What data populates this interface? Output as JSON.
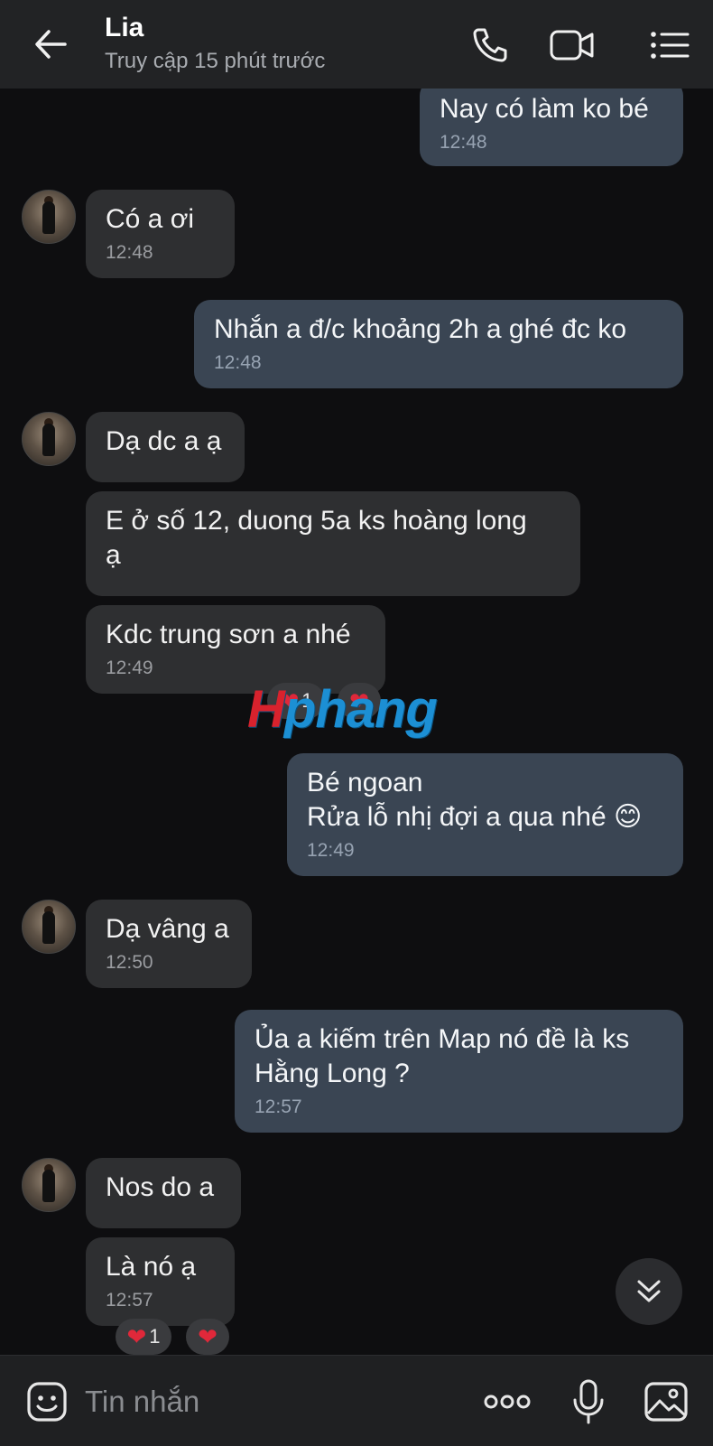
{
  "header": {
    "contact_name": "Lia",
    "status": "Truy cập 15 phút trước",
    "icons": [
      "back-arrow-icon",
      "phone-icon",
      "video-call-icon",
      "list-menu-icon"
    ]
  },
  "messages": [
    {
      "side": "out",
      "text": "Nay có làm ko bé",
      "time": "12:48"
    },
    {
      "side": "in",
      "text": "Có a ơi",
      "time": "12:48"
    },
    {
      "side": "out",
      "text": "Nhắn a đ/c khoảng 2h a ghé đc ko",
      "time": "12:48"
    },
    {
      "side": "in",
      "text": "Dạ dc a ạ",
      "time": ""
    },
    {
      "side": "in",
      "text": "E ở số 12, duong 5a ks hoàng long\nạ",
      "time": ""
    },
    {
      "side": "in",
      "text": "Kdc trung sơn a nhé",
      "time": "12:49"
    },
    {
      "side": "out",
      "text": "Bé ngoan\nRửa lỗ nhị đợi a qua nhé 😊",
      "time": "12:49"
    },
    {
      "side": "in",
      "text": "Dạ vâng a",
      "time": "12:50"
    },
    {
      "side": "out",
      "text": "Ủa a kiếm trên Map nó đề là ks\nHằng Long ?",
      "time": "12:57"
    },
    {
      "side": "in",
      "text": "Nos do a",
      "time": ""
    },
    {
      "side": "in",
      "text": "Là nó ạ",
      "time": "12:57"
    }
  ],
  "reactions": [
    {
      "emoji": "❤️",
      "count": "1"
    },
    {
      "emoji": "❤️",
      "count": ""
    },
    {
      "emoji": "❤️",
      "count": "1"
    },
    {
      "emoji": "❤️",
      "count": ""
    }
  ],
  "watermark": {
    "part1": "H",
    "part2": "phang"
  },
  "input": {
    "placeholder": "Tin nhắn",
    "value": "",
    "icons": [
      "sticker-icon",
      "more-options-icon",
      "microphone-icon",
      "image-icon"
    ]
  },
  "colors": {
    "background": "#0e0e10",
    "header": "#222325",
    "incoming_bubble": "#2e2f31",
    "outgoing_bubble": "#3a4553",
    "heart": "#e0283a"
  }
}
